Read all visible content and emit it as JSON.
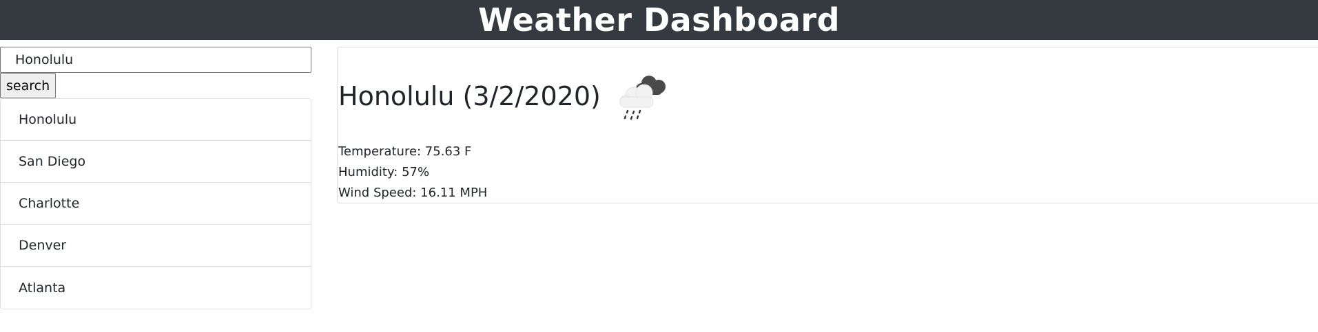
{
  "header": {
    "title": "Weather Dashboard",
    "background_color": "#343a40"
  },
  "search": {
    "value": "Honolulu",
    "button_label": "search"
  },
  "history": {
    "items": [
      {
        "label": "Honolulu"
      },
      {
        "label": "San Diego"
      },
      {
        "label": "Charlotte"
      },
      {
        "label": "Denver"
      },
      {
        "label": "Atlanta"
      }
    ]
  },
  "current": {
    "title": "Honolulu (3/2/2020)",
    "icon": "rain-cloud-icon",
    "temperature": "Temperature: 75.63 F",
    "humidity": "Humidity: 57%",
    "wind_speed": "Wind Speed: 16.11 MPH"
  }
}
